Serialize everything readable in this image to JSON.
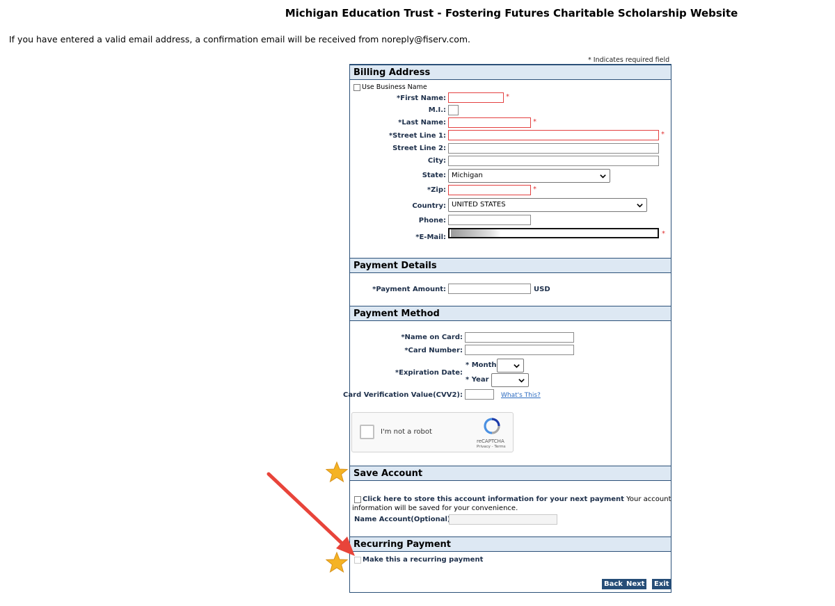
{
  "header": {
    "title": "Michigan Education Trust - Fostering Futures Charitable Scholarship Website",
    "confirmation_note": "If you have entered a valid email address, a confirmation email will be received from noreply@fiserv.com.",
    "required_note": "* Indicates required field"
  },
  "billing": {
    "heading": "Billing Address",
    "use_business_name": "Use Business Name",
    "first_name_label": "*First Name:",
    "mi_label": "M.I.:",
    "last_name_label": "*Last Name:",
    "street1_label": "*Street Line 1:",
    "street2_label": "Street Line 2:",
    "city_label": "City:",
    "state_label": "State:",
    "state_value": "Michigan",
    "zip_label": "*Zip:",
    "country_label": "Country:",
    "country_value": "UNITED STATES",
    "phone_label": "Phone:",
    "email_label": "*E-Mail:",
    "required_star": "*"
  },
  "payment_details": {
    "heading": "Payment Details",
    "amount_label": "*Payment Amount:",
    "currency": "USD"
  },
  "payment_method": {
    "heading": "Payment Method",
    "name_on_card_label": "*Name on Card:",
    "card_number_label": "*Card Number:",
    "expiration_label": "*Expiration Date:",
    "month_label": "* Month",
    "year_label": "* Year",
    "cvv_label": "Card Verification Value(CVV2):",
    "whats_this": "What's This?"
  },
  "recaptcha": {
    "label": "I'm not a robot",
    "brand": "reCAPTCHA",
    "links": "Privacy - Terms"
  },
  "save_account": {
    "heading": "Save Account",
    "store_bold": "Click here to store this account information for your next payment",
    "store_rest_1": "Your account",
    "store_rest_2": "information will be saved for your convenience.",
    "name_account_label": "Name Account(Optional):"
  },
  "recurring": {
    "heading": "Recurring Payment",
    "checkbox_label": "Make this a recurring payment"
  },
  "buttons": {
    "back": "Back",
    "next": "Next",
    "exit": "Exit"
  },
  "colors": {
    "header_bg": "#dde8f3",
    "border": "#2b5078",
    "required": "#e03030",
    "button_bg": "#264d77",
    "annotation_arrow": "#e8443a",
    "annotation_star": "#f5b324"
  }
}
